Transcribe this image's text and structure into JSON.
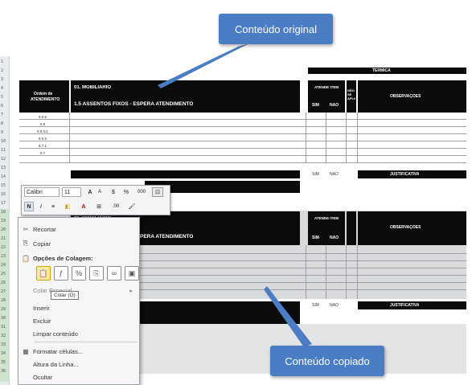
{
  "callouts": {
    "top": "Conteúdo original",
    "bottom": "Conteúdo copiado"
  },
  "sheet": {
    "top_band_title": "TÉRMICA",
    "left_header": [
      "Ordem de",
      "ATENDIMENTO"
    ],
    "section_title": "01. MOBILIÁRIO",
    "section_subtitle": "1.5 ASSENTOS FIXOS - ESPERA ATENDIMENTO",
    "col_group_label": "ATENDE ITEM",
    "col_sim": "SIM",
    "col_nao": "NÃO",
    "col_nao_aplica": "NÃO SE APLICA",
    "col_observacoes": "OBSERVAÇÕES",
    "col_justificativa": "JUSTIFICATIVA",
    "row_codes": [
      "8.9.5",
      "8.9",
      "8.9.5.1",
      "8.9.6",
      "8.7.1",
      "8.7"
    ],
    "row_numbers": [
      "1",
      "2",
      "3",
      "4",
      "5",
      "6",
      "7",
      "8",
      "9",
      "10",
      "11",
      "12",
      "13",
      "14",
      "15",
      "16",
      "17",
      "18",
      "19",
      "20",
      "21",
      "22",
      "23",
      "24",
      "25",
      "26",
      "27",
      "28",
      "29",
      "30",
      "31",
      "32",
      "33",
      "34",
      "35",
      "36"
    ]
  },
  "mini_toolbar": {
    "font_name": "Calibri",
    "font_size": "11",
    "buttons_row1": [
      "A",
      "A",
      "$",
      "%",
      "000"
    ],
    "buttons_row2": [
      "N",
      "I",
      "≡",
      "A",
      "⊞",
      ".00",
      "🖌"
    ]
  },
  "context_menu": {
    "items": [
      {
        "label": "Recortar",
        "icon": "scissors-icon",
        "glyph": "✂"
      },
      {
        "label": "Copiar",
        "icon": "copy-icon",
        "glyph": "⎘"
      },
      {
        "label": "Opções de Colagem:",
        "icon": "paste-options-icon",
        "glyph": "📋"
      },
      {
        "label": "Colar Especial...",
        "icon": "",
        "glyph": ""
      },
      {
        "label": "Inserir",
        "icon": "",
        "glyph": ""
      },
      {
        "label": "Excluir",
        "icon": "",
        "glyph": ""
      },
      {
        "label": "Limpar conteúdo",
        "icon": "",
        "glyph": ""
      },
      {
        "label": "Formatar células...",
        "icon": "format-cells-icon",
        "glyph": "▦"
      },
      {
        "label": "Altura da Linha...",
        "icon": "",
        "glyph": ""
      },
      {
        "label": "Ocultar",
        "icon": "",
        "glyph": ""
      }
    ],
    "paste_icons": [
      "paste-icon",
      "paste-formulas-icon",
      "paste-formatting-icon",
      "paste-values-icon",
      "paste-link-icon",
      "paste-picture-icon"
    ],
    "tooltip": "Colar (O)"
  }
}
